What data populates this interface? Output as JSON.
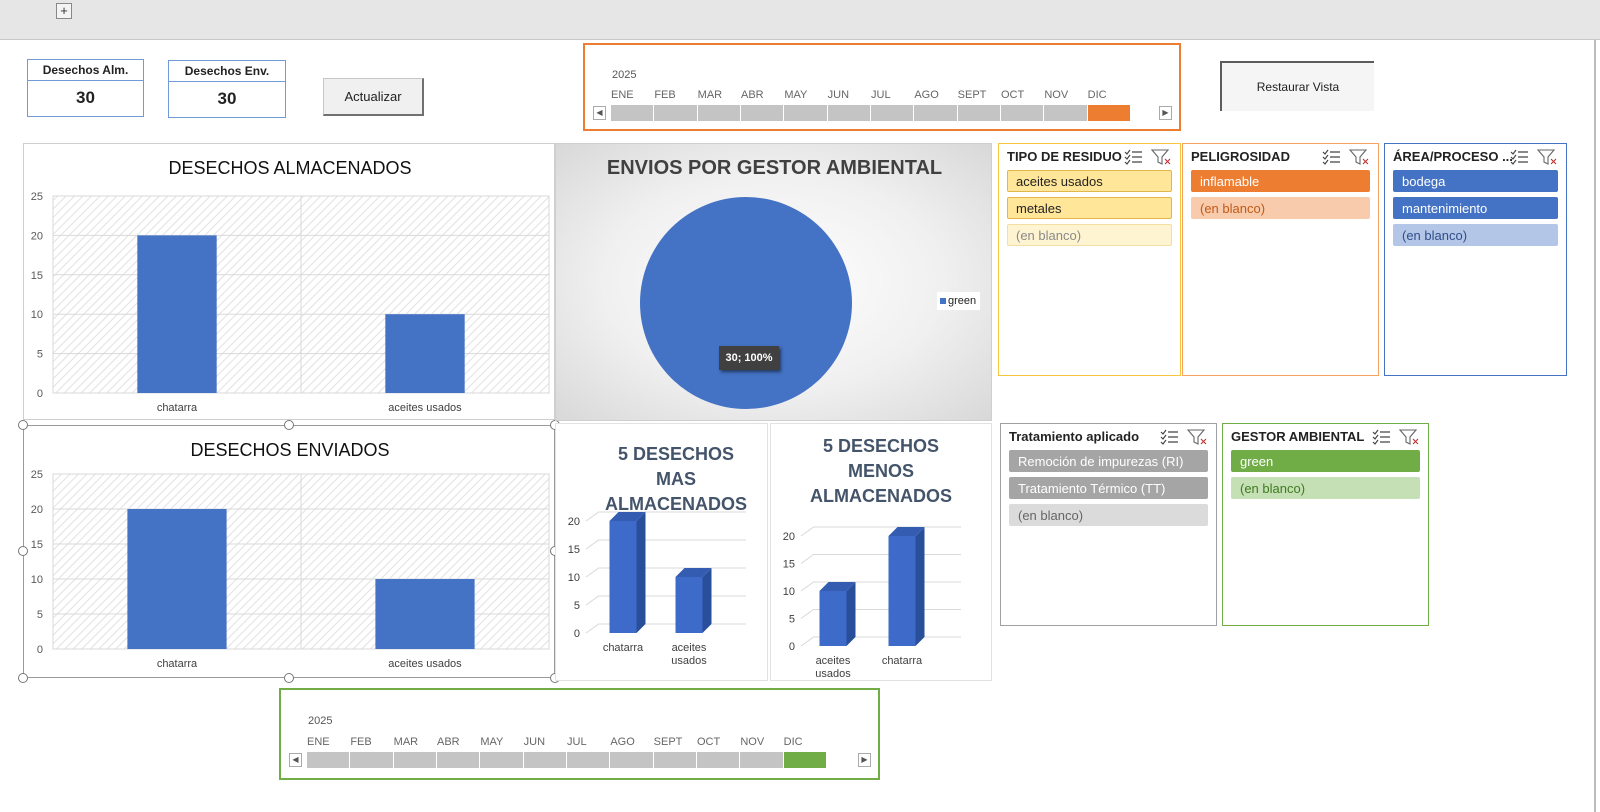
{
  "kpis": [
    {
      "label": "Desechos Alm.",
      "value": "30"
    },
    {
      "label": "Desechos Env.",
      "value": "30"
    }
  ],
  "buttons": {
    "actualizar": "Actualizar",
    "restaurar": "Restaurar Vista"
  },
  "timeline_top": {
    "year": "2025",
    "months": [
      "ENE",
      "FEB",
      "MAR",
      "ABR",
      "MAY",
      "JUN",
      "JUL",
      "AGO",
      "SEPT",
      "OCT",
      "NOV",
      "DIC"
    ],
    "selected": "DIC",
    "accent": "#ED7D31"
  },
  "timeline_bottom": {
    "year": "2025",
    "months": [
      "ENE",
      "FEB",
      "MAR",
      "ABR",
      "MAY",
      "JUN",
      "JUL",
      "AGO",
      "SEPT",
      "OCT",
      "NOV",
      "DIC"
    ],
    "selected": "DIC",
    "accent": "#70AD47"
  },
  "slicers": {
    "tipo": {
      "title": "TIPO DE RESIDUO",
      "items": [
        "aceites usados",
        "metales",
        "(en blanco)"
      ]
    },
    "peligrosidad": {
      "title": "PELIGROSIDAD",
      "items": [
        "inflamable",
        "(en blanco)"
      ]
    },
    "area": {
      "title": "ÁREA/PROCESO ...",
      "items": [
        "bodega",
        "mantenimiento",
        "(en blanco)"
      ]
    },
    "tratamiento": {
      "title": "Tratamiento aplicado",
      "items": [
        "Remoción de impurezas (RI)",
        "Tratamiento Térmico (TT)",
        "(en blanco)"
      ]
    },
    "gestor": {
      "title": "GESTOR AMBIENTAL",
      "items": [
        "green",
        "(en blanco)"
      ]
    }
  },
  "chart_data": [
    {
      "type": "bar",
      "title": "DESECHOS ALMACENADOS",
      "categories": [
        "chatarra",
        "aceites usados"
      ],
      "values": [
        20,
        10
      ],
      "ylim": [
        0,
        25
      ],
      "yticks": [
        "0",
        "5",
        "10",
        "15",
        "20",
        "25"
      ],
      "color": "#4472C4",
      "grid": true
    },
    {
      "type": "bar",
      "title": "DESECHOS ENVIADOS",
      "categories": [
        "chatarra",
        "aceites usados"
      ],
      "values": [
        20,
        10
      ],
      "ylim": [
        0,
        25
      ],
      "yticks": [
        "0",
        "5",
        "10",
        "15",
        "20",
        "25"
      ],
      "color": "#4472C4",
      "grid": true
    },
    {
      "type": "pie",
      "title": "ENVIOS POR GESTOR AMBIENTAL",
      "series": [
        {
          "name": "green",
          "values": [
            30
          ]
        }
      ],
      "data_label": "30; 100%",
      "legend": "right",
      "color": "#4472C4"
    },
    {
      "type": "bar",
      "title": "5 DESECHOS MAS ALMACENADOS",
      "categories": [
        "chatarra",
        "aceites usados"
      ],
      "values": [
        20,
        10
      ],
      "ylim": [
        0,
        20
      ],
      "yticks": [
        "0",
        "5",
        "10",
        "15",
        "20"
      ],
      "style": "3d",
      "color": "#3E6BC9"
    },
    {
      "type": "bar",
      "title": "5 DESECHOS MENOS ALMACENADOS",
      "categories": [
        "aceites usados",
        "chatarra"
      ],
      "values": [
        10,
        20
      ],
      "ylim": [
        0,
        20
      ],
      "yticks": [
        "0",
        "5",
        "10",
        "15",
        "20"
      ],
      "style": "3d",
      "color": "#3E6BC9"
    }
  ]
}
